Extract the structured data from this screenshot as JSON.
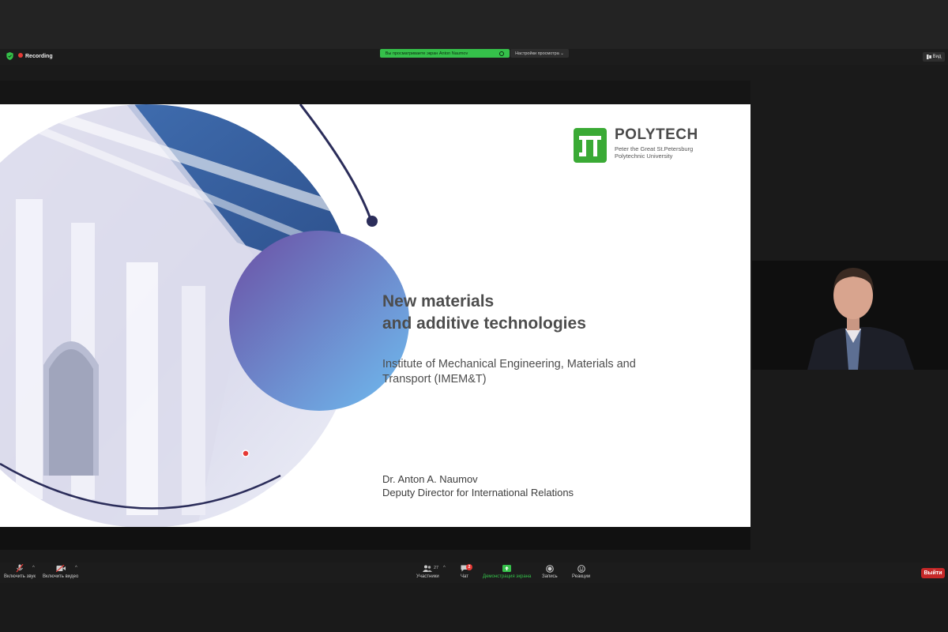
{
  "status": {
    "recording_label": "Recording",
    "share_banner_text": "Вы просматриваете экран Anton Naumov",
    "view_options_label": "Настройки просмотра",
    "view_label": "Вид"
  },
  "slide": {
    "logo_title": "POLYTECH",
    "logo_sub": "Peter the Great St.Petersburg Polytechnic University",
    "title_line1": "New materials",
    "title_line2": "and additive technologies",
    "subtitle": "Institute of Mechanical Engineering, Materials and Transport (IMEM&T)",
    "author_name": "Dr. Anton A. Naumov",
    "author_role": "Deputy Director for International Relations"
  },
  "toolbar": {
    "audio_label": "Включить звук",
    "video_label": "Включить видео",
    "participants_label": "Участники",
    "participants_count": "27",
    "chat_label": "Чат",
    "chat_badge": "2",
    "share_label": "Демонстрация экрана",
    "record_label": "Запись",
    "reactions_label": "Реакции",
    "leave_label": "Выйти"
  },
  "colors": {
    "share_green": "#35c04a",
    "leave_red": "#c62828",
    "polytech_green": "#3aaa35",
    "circle_purple": "#6b5aa8",
    "circle_blue": "#6fb6ea"
  }
}
